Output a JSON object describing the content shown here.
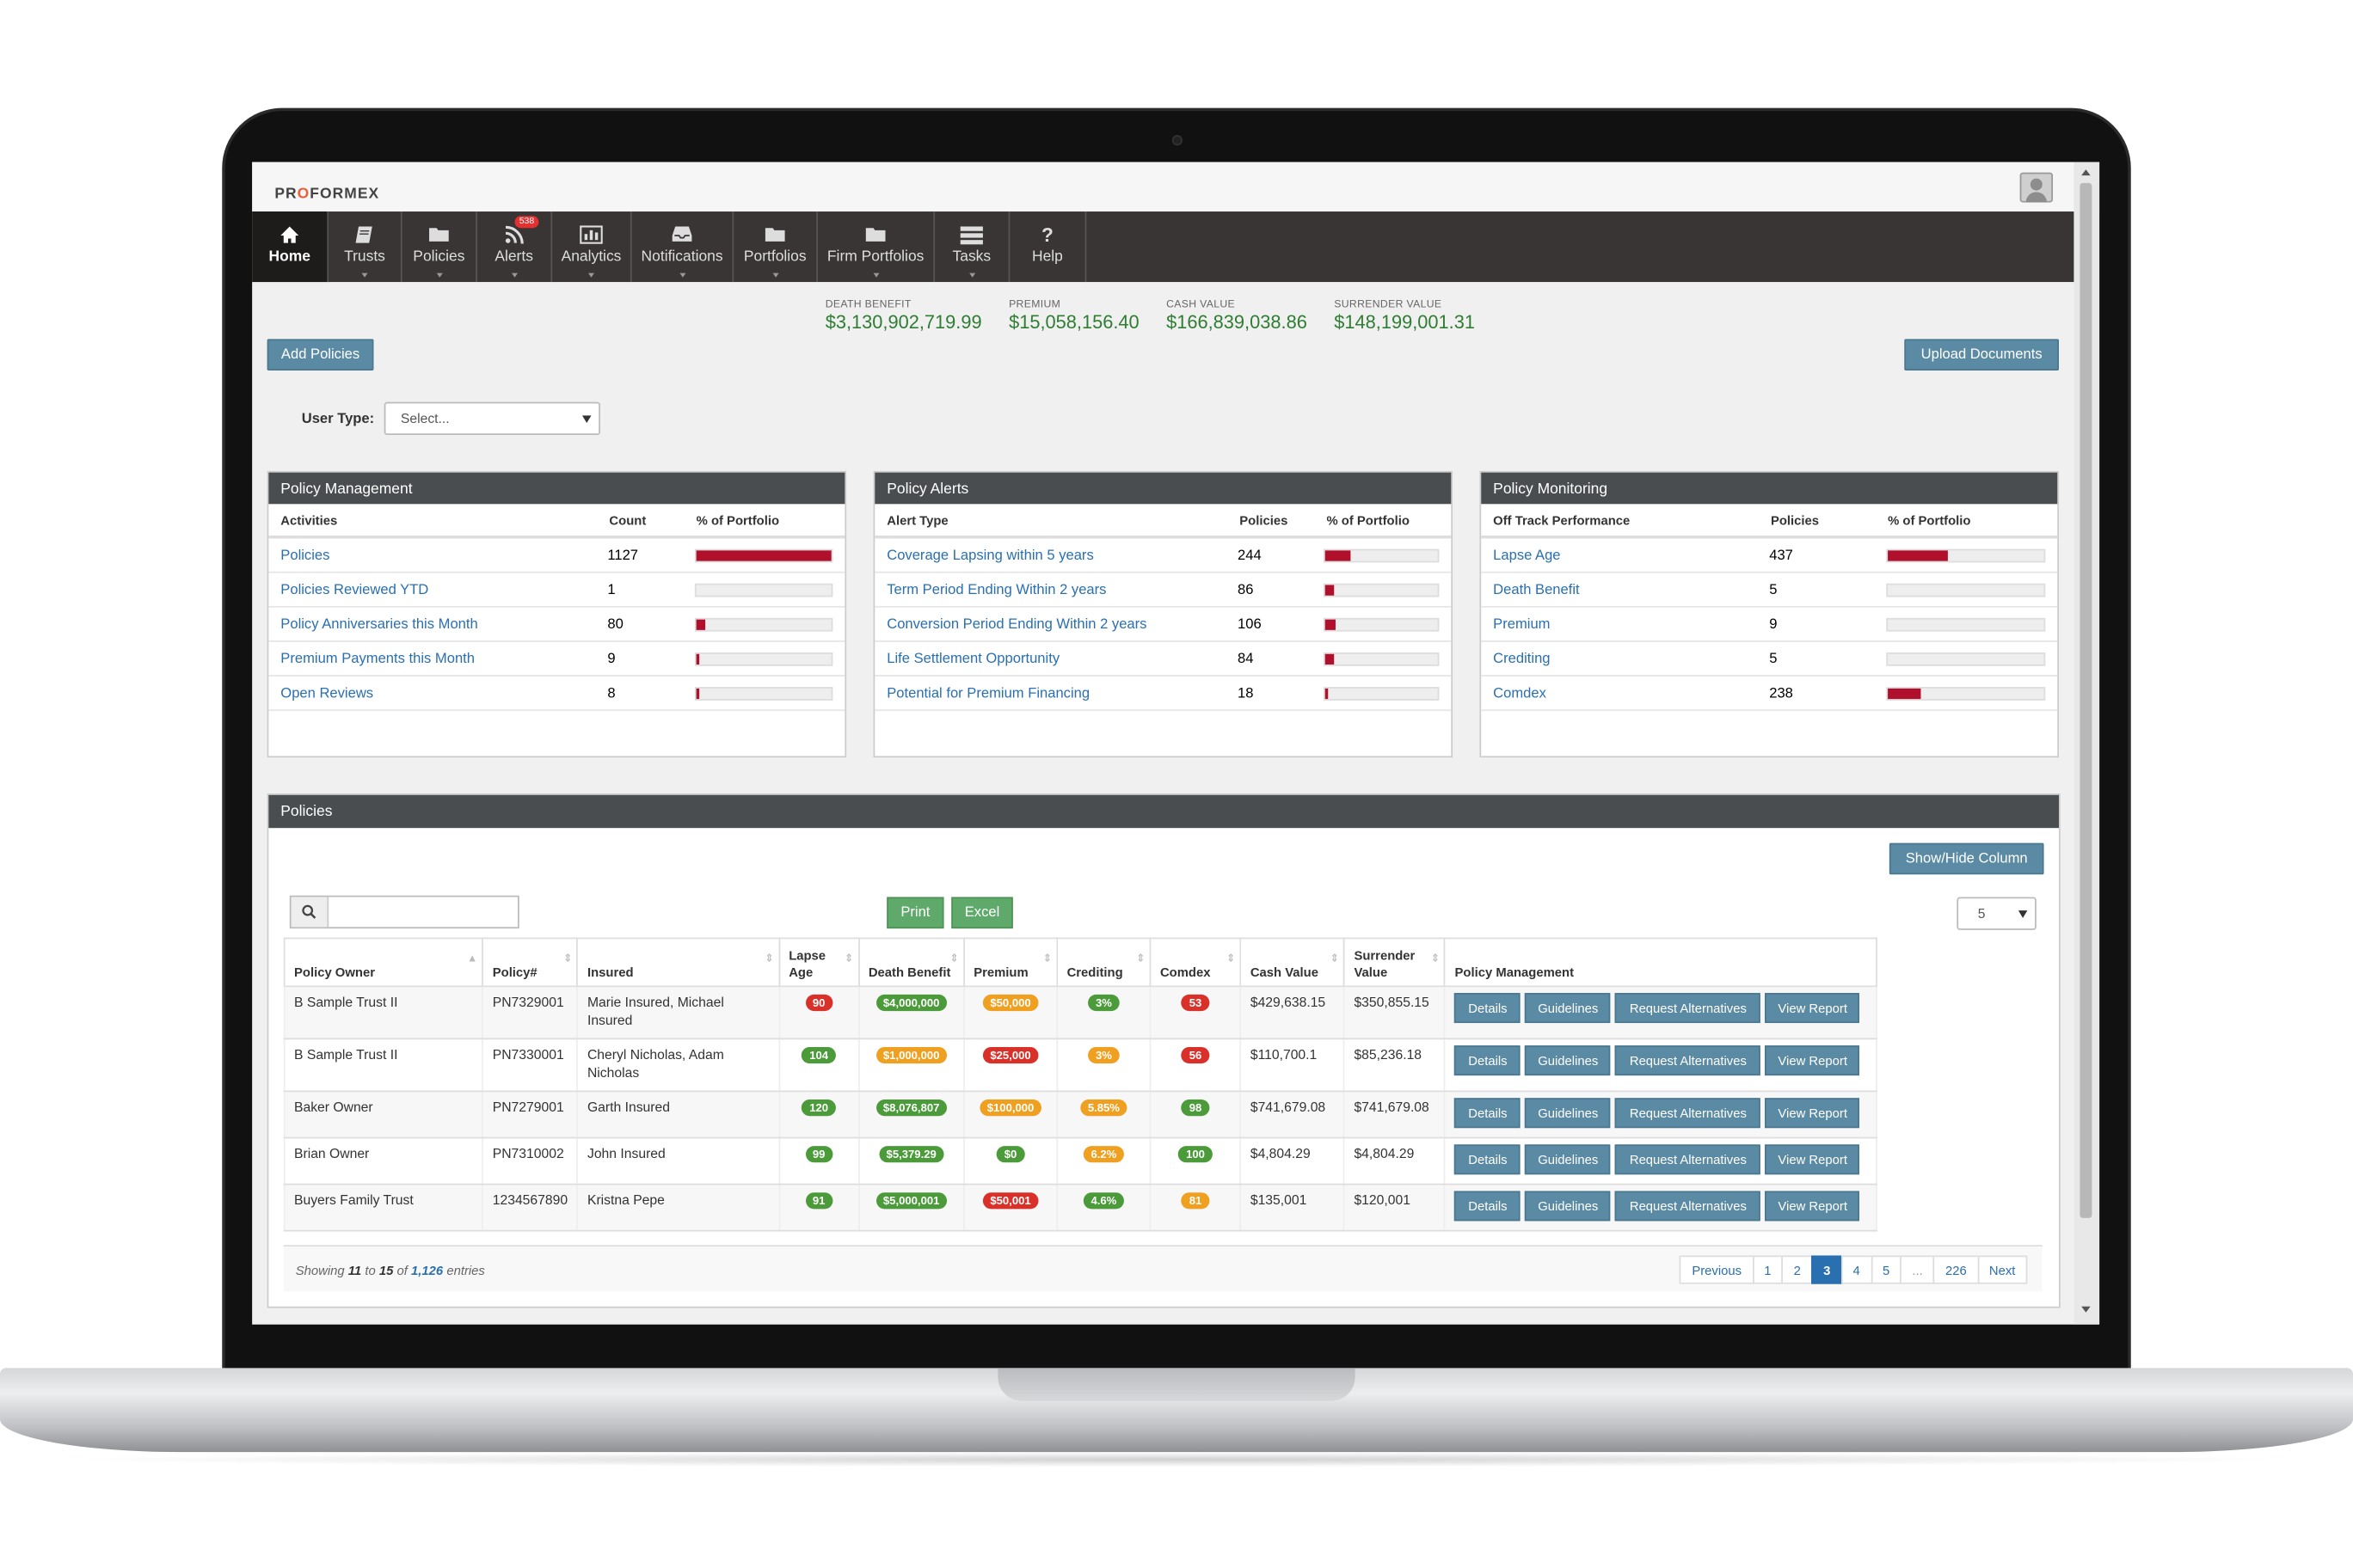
{
  "app": {
    "logo_prefix": "PR",
    "logo_accent": "O",
    "logo_suffix": "FORMEX"
  },
  "nav": [
    {
      "label": "Home",
      "icon": "home-icon",
      "active": true
    },
    {
      "label": "Trusts",
      "icon": "book-icon"
    },
    {
      "label": "Policies",
      "icon": "folder-icon"
    },
    {
      "label": "Alerts",
      "icon": "rss-icon",
      "badge": "538"
    },
    {
      "label": "Analytics",
      "icon": "bar-chart-icon"
    },
    {
      "label": "Notifications",
      "icon": "inbox-icon"
    },
    {
      "label": "Portfolios",
      "icon": "folder-icon"
    },
    {
      "label": "Firm Portfolios",
      "icon": "folder-icon"
    },
    {
      "label": "Tasks",
      "icon": "tasks-icon"
    },
    {
      "label": "Help",
      "icon": "question-icon",
      "glyph": "?"
    }
  ],
  "stats": [
    {
      "label": "DEATH BENEFIT",
      "value": "$3,130,902,719.99"
    },
    {
      "label": "PREMIUM",
      "value": "$15,058,156.40"
    },
    {
      "label": "CASH VALUE",
      "value": "$166,839,038.86"
    },
    {
      "label": "SURRENDER VALUE",
      "value": "$148,199,001.31"
    }
  ],
  "buttons": {
    "add_policies": "Add Policies",
    "upload_documents": "Upload Documents",
    "show_hide": "Show/Hide Column",
    "print": "Print",
    "excel": "Excel"
  },
  "user_type": {
    "label": "User Type:",
    "value": "Select..."
  },
  "panels": {
    "management": {
      "title": "Policy Management",
      "headers": [
        "Activities",
        "Count",
        "% of Portfolio"
      ],
      "rows": [
        {
          "label": "Policies",
          "count": "1127",
          "pct": 100
        },
        {
          "label": "Policies Reviewed YTD",
          "count": "1",
          "pct": 0
        },
        {
          "label": "Policy Anniversaries this Month",
          "count": "80",
          "pct": 7
        },
        {
          "label": "Premium Payments this Month",
          "count": "9",
          "pct": 1
        },
        {
          "label": "Open Reviews",
          "count": "8",
          "pct": 1
        }
      ]
    },
    "alerts": {
      "title": "Policy Alerts",
      "headers": [
        "Alert Type",
        "Policies",
        "% of Portfolio"
      ],
      "rows": [
        {
          "label": "Coverage Lapsing within 5 years",
          "count": "244",
          "pct": 22
        },
        {
          "label": "Term Period Ending Within 2 years",
          "count": "86",
          "pct": 8
        },
        {
          "label": "Conversion Period Ending Within 2 years",
          "count": "106",
          "pct": 9
        },
        {
          "label": "Life Settlement Opportunity",
          "count": "84",
          "pct": 7
        },
        {
          "label": "Potential for Premium Financing",
          "count": "18",
          "pct": 2
        }
      ]
    },
    "monitoring": {
      "title": "Policy Monitoring",
      "headers": [
        "Off Track Performance",
        "Policies",
        "% of Portfolio"
      ],
      "rows": [
        {
          "label": "Lapse Age",
          "count": "437",
          "pct": 39
        },
        {
          "label": "Death Benefit",
          "count": "5",
          "pct": 0
        },
        {
          "label": "Premium",
          "count": "9",
          "pct": 0
        },
        {
          "label": "Crediting",
          "count": "5",
          "pct": 0
        },
        {
          "label": "Comdex",
          "count": "238",
          "pct": 21
        }
      ]
    }
  },
  "policies": {
    "title": "Policies",
    "page_size": "5",
    "columns": [
      "Policy Owner",
      "Policy#",
      "Insured",
      "Lapse Age",
      "Death Benefit",
      "Premium",
      "Crediting",
      "Comdex",
      "Cash Value",
      "Surrender Value",
      "Policy Management"
    ],
    "rows": [
      {
        "owner": "B Sample Trust II",
        "policy": "PN7329001",
        "insured": "Marie Insured, Michael Insured",
        "lapse": "90",
        "lapse_c": "#d9312a",
        "db": "$4,000,000",
        "db_c": "#4b9b3a",
        "prem": "$50,000",
        "prem_c": "#f0a020",
        "cred": "3%",
        "cred_c": "#4b9b3a",
        "comdex": "53",
        "comdex_c": "#d9312a",
        "cash": "$429,638.15",
        "surr": "$350,855.15"
      },
      {
        "owner": "B Sample Trust II",
        "policy": "PN7330001",
        "insured": "Cheryl Nicholas, Adam Nicholas",
        "lapse": "104",
        "lapse_c": "#4b9b3a",
        "db": "$1,000,000",
        "db_c": "#f0a020",
        "prem": "$25,000",
        "prem_c": "#d9312a",
        "cred": "3%",
        "cred_c": "#f0a020",
        "comdex": "56",
        "comdex_c": "#d9312a",
        "cash": "$110,700.1",
        "surr": "$85,236.18"
      },
      {
        "owner": "Baker Owner",
        "policy": "PN7279001",
        "insured": "Garth Insured",
        "lapse": "120",
        "lapse_c": "#4b9b3a",
        "db": "$8,076,807",
        "db_c": "#4b9b3a",
        "prem": "$100,000",
        "prem_c": "#f0a020",
        "cred": "5.85%",
        "cred_c": "#f0a020",
        "comdex": "98",
        "comdex_c": "#4b9b3a",
        "cash": "$741,679.08",
        "surr": "$741,679.08"
      },
      {
        "owner": "Brian Owner",
        "policy": "PN7310002",
        "insured": "John Insured",
        "lapse": "99",
        "lapse_c": "#4b9b3a",
        "db": "$5,379.29",
        "db_c": "#4b9b3a",
        "prem": "$0",
        "prem_c": "#4b9b3a",
        "cred": "6.2%",
        "cred_c": "#f0a020",
        "comdex": "100",
        "comdex_c": "#4b9b3a",
        "cash": "$4,804.29",
        "surr": "$4,804.29"
      },
      {
        "owner": "Buyers Family Trust",
        "policy": "1234567890",
        "insured": "Kristna Pepe",
        "lapse": "91",
        "lapse_c": "#4b9b3a",
        "db": "$5,000,001",
        "db_c": "#4b9b3a",
        "prem": "$50,001",
        "prem_c": "#d9312a",
        "cred": "4.6%",
        "cred_c": "#4b9b3a",
        "comdex": "81",
        "comdex_c": "#f0a020",
        "cash": "$135,001",
        "surr": "$120,001"
      }
    ],
    "actions": [
      "Details",
      "Guidelines",
      "Request Alternatives",
      "View Report"
    ],
    "footer": {
      "showing": "Showing",
      "from": "11",
      "to_word": "to",
      "to": "15",
      "of_word": "of",
      "total": "1,126",
      "entries": "entries"
    },
    "pages": [
      "Previous",
      "1",
      "2",
      "3",
      "4",
      "5",
      "...",
      "226",
      "Next"
    ],
    "current_page": "3"
  }
}
